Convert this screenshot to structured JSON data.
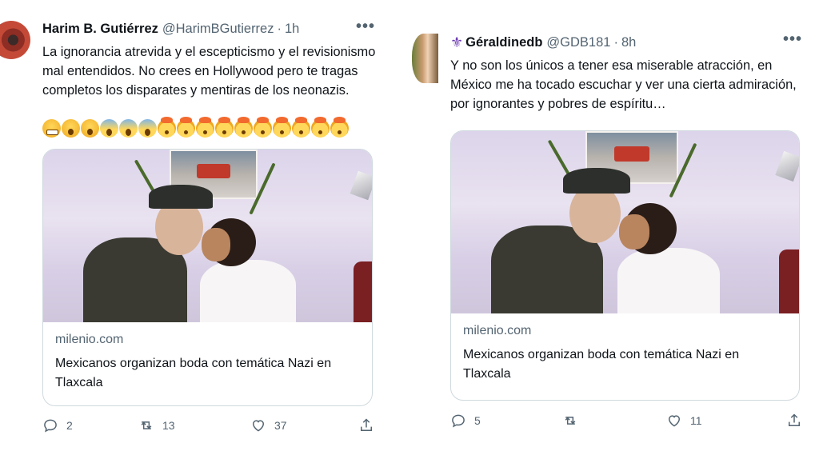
{
  "tweets": [
    {
      "display_name": "Harim B. Gutiérrez",
      "handle": "@HarimBGutierrez",
      "separator": "·",
      "time": "1h",
      "more": "•••",
      "text": "La ignorancia atrevida y el escepticismo y el revisionismo mal entendidos. No crees en Hollywood pero te tragas completos los disparates y mentiras de los neonazis.",
      "emojis": [
        "grimace-emoji",
        "astonished-emoji",
        "astonished-emoji",
        "scream-emoji",
        "scream-emoji",
        "scream-emoji",
        "mind-blown-emoji",
        "mind-blown-emoji",
        "mind-blown-emoji",
        "mind-blown-emoji",
        "mind-blown-emoji",
        "mind-blown-emoji",
        "mind-blown-emoji",
        "mind-blown-emoji",
        "mind-blown-emoji",
        "mind-blown-emoji"
      ],
      "card": {
        "domain": "milenio.com",
        "title": "Mexicanos organizan boda con temática Nazi en Tlaxcala"
      },
      "actions": {
        "replies": "2",
        "retweets": "13",
        "likes": "37"
      }
    },
    {
      "display_name": "Géraldinedb",
      "name_icon": "fleur-de-lis-icon",
      "handle": "@GDB181",
      "separator": "·",
      "time": "8h",
      "more": "•••",
      "text": "Y no son los únicos a tener esa miserable atracción, en México me ha tocado escuchar y ver una cierta admiración, por ignorantes y pobres de espíritu…",
      "card": {
        "domain": "milenio.com",
        "title": "Mexicanos organizan boda con temática Nazi en Tlaxcala"
      },
      "actions": {
        "replies": "5",
        "retweets": "",
        "likes": "11"
      }
    }
  ],
  "colors": {
    "text": "#0f1419",
    "secondary": "#536471",
    "border": "#cfd9de"
  }
}
